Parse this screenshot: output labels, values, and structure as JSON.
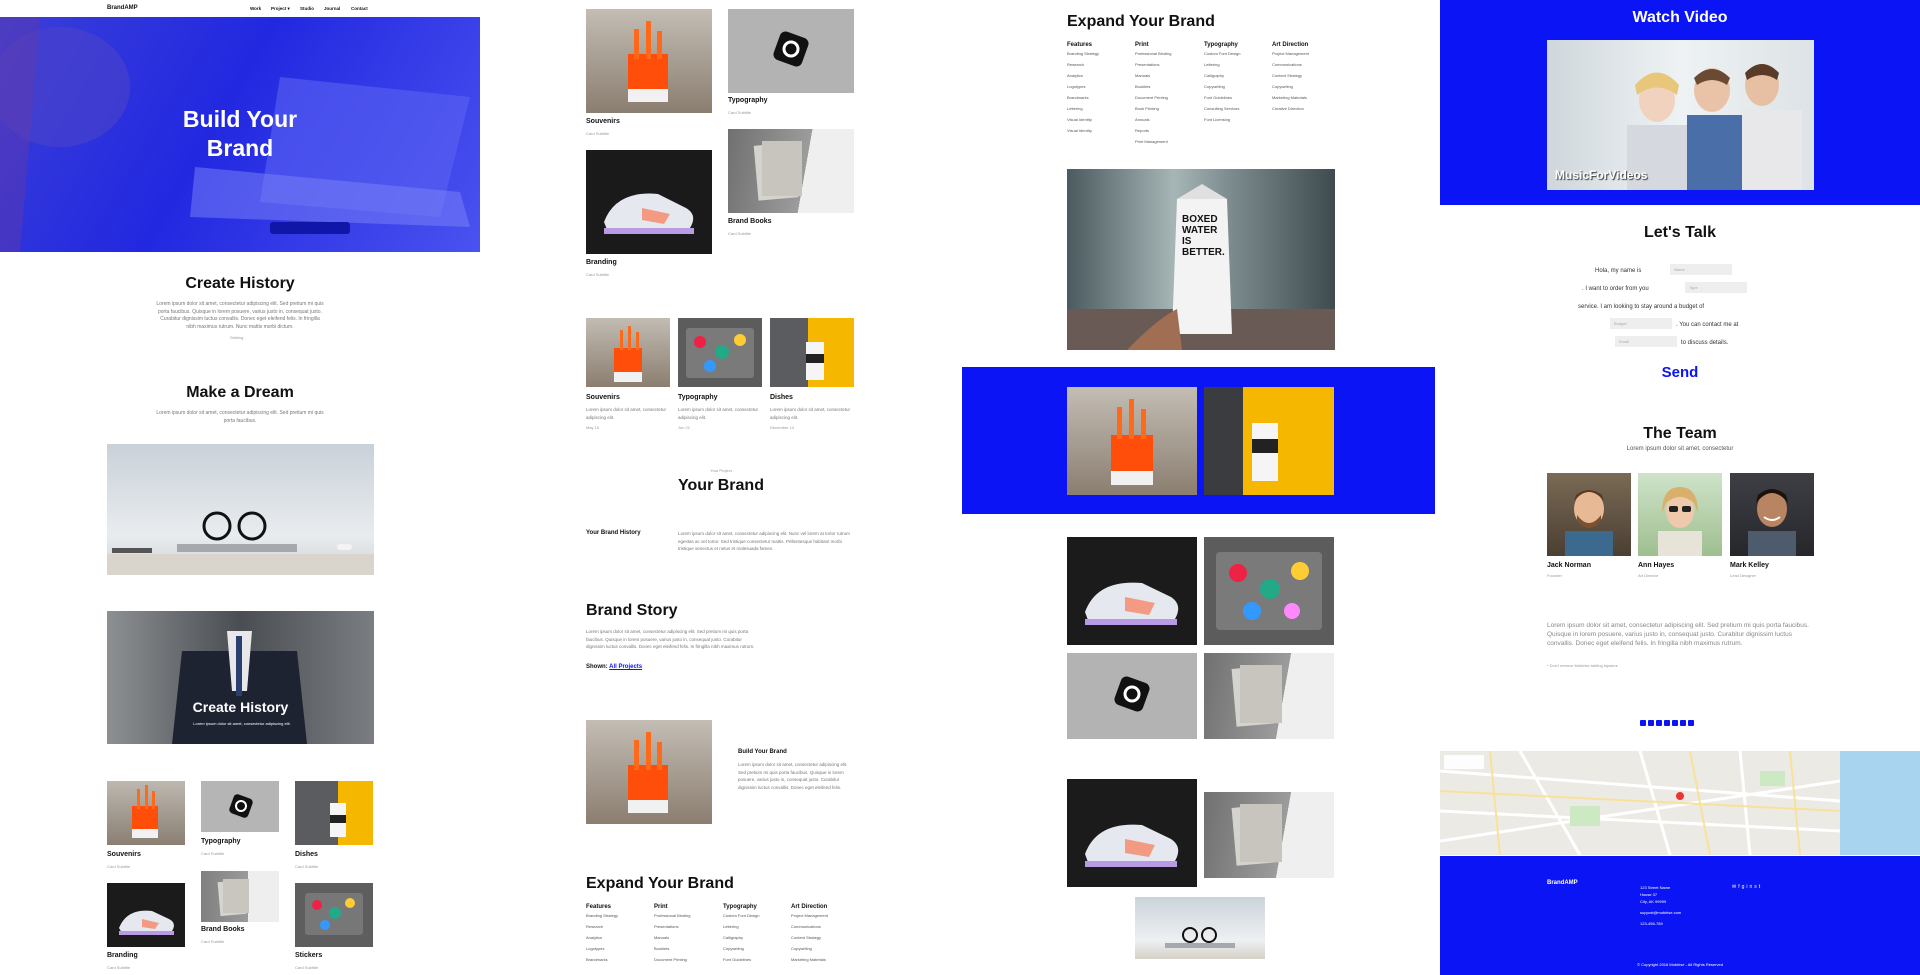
{
  "nav": {
    "brand": "BrandAMP",
    "items": [
      "Work",
      "Project ▾",
      "Studio",
      "Journal",
      "Contact"
    ]
  },
  "hero": {
    "title": "Build Your Brand"
  },
  "history": {
    "title": "Create History",
    "text": "Lorem ipsum dolor sit amet, consectetur adipiscing elit. Sed pretium mi quis porta faucibus. Quisque in lorem posuere, varius justo in, consequat justo. Curabitur dignissim luctus convallis. Donec eget eleifend felis. In fringilla nibh maximus rutrum. Nunc mattis morbi dictum.",
    "caption": "Striking"
  },
  "dream": {
    "title": "Make a Dream",
    "text": "Lorem ipsum dolor sit amet, consectetur adipiscing elit. Sed pretium mi quis porta faucibus."
  },
  "history2": {
    "title": "Create History",
    "text": "Lorem ipsum dolor sit amet, consectetur adipiscing elit."
  },
  "cards": {
    "souvenirs": "Souvenirs",
    "typography": "Typography",
    "dishes": "Dishes",
    "branding": "Branding",
    "brand_books": "Brand Books",
    "stickers": "Stickers",
    "subtitle": "Card Subtitle"
  },
  "col2": {
    "cards_text": "Lorem ipsum dolor sit amet, consectetur adipiscing elit.",
    "dates": [
      "May 10",
      "Jun 21",
      "December 14"
    ],
    "project_kicker": "Your Project",
    "project_title": "Your Brand",
    "history_label": "Your Brand History",
    "history_text": "Lorem ipsum dolor sit amet, consectetur adipiscing elit. Nunc vel lorem at tortor rutrum egestas ac vel tortor. Sed tristique consectetur mattis. Pellentesque habitant morbi tristique senectus et netus et malesuada fames.",
    "story_title": "Brand Story",
    "story_text": "Lorem ipsum dolor sit amet, consectetur adipiscing elit. Sed pretium mi quis porta faucibus. Quisque in lorem posuere, varius justo in, consequat justo. Curabitur dignissim luctus convallis. Donec eget eleifend felis. In fringilla nibh maximus rutrum.",
    "shown_label": "Shown:",
    "shown_link": "All Projects",
    "build_title": "Build Your Brand",
    "build_text": "Lorem ipsum dolor sit amet, consectetur adipiscing elit. Sed pretium mi quis porta faucibus. Quisque in lorem posuere, varius justo in, consequat justo. Curabitur dignissim luctus convallis. Donec eget eleifend felis."
  },
  "expand": {
    "title": "Expand Your Brand",
    "cols": [
      {
        "head": "Features",
        "items": [
          "Branding Strategy",
          "Research",
          "Analytics",
          "Logotypes",
          "Brandmarks",
          "Lettering",
          "Visual Identity",
          "Visual Identity"
        ]
      },
      {
        "head": "Print",
        "items": [
          "Professional Binding",
          "Presentations",
          "Manuals",
          "Booklets",
          "Document Printing",
          "Book Printing",
          "Annuals",
          "Reports",
          "Print Management"
        ]
      },
      {
        "head": "Typography",
        "items": [
          "Custom Font Design",
          "Lettering",
          "Calligraphy",
          "Copywriting",
          "Font Guidelines",
          "Consulting Services",
          "Font Licensing"
        ]
      },
      {
        "head": "Art Direction",
        "items": [
          "Project Management",
          "Communications",
          "Content Strategy",
          "Copywriting",
          "Marketing Materials",
          "Creative Direction"
        ]
      }
    ]
  },
  "product_text": {
    "line1": "BOXED",
    "line2": "WATER",
    "line3": "IS",
    "line4": "BETTER."
  },
  "video": {
    "title": "Watch Video",
    "watermark": "MusicForVideos"
  },
  "talk": {
    "title": "Let's Talk",
    "s1": "Hola, my name is",
    "s2": ". I want to order from you",
    "s3": "service. I am looking to stay around a budget of",
    "s4": ". You can contact me at",
    "s5": "to discuss details.",
    "ph_name": "Name",
    "ph_type": "Type",
    "ph_budget": "Budget",
    "ph_email": "Email",
    "send": "Send"
  },
  "team": {
    "title": "The Team",
    "subtitle": "Lorem ipsum dolor sit amet, consectetur",
    "members": [
      {
        "name": "Jack Norman",
        "role": "Founder"
      },
      {
        "name": "Ann Hayes",
        "role": "Art Director"
      },
      {
        "name": "Mark Kelley",
        "role": "Lead Designer"
      }
    ],
    "text": "Lorem ipsum dolor sit amet, consectetur adipiscing elit. Sed pretium mi quis porta faucibus. Quisque in lorem posuere, varius justo in, consequat justo. Curabitur dignissim luctus convallis. Donec eget eleifend felis. In fringilla nibh maximus rutrum.",
    "note": "* Don't remove Mobirise adding hipsters"
  },
  "footer": {
    "brand": "BrandAMP",
    "address": [
      "123 Street Name",
      "House 37",
      "City, AK 99999"
    ],
    "email": "support@mobirise.com",
    "phone": "123-456-789",
    "copyright": "© Copyright 2016 Mobirise - All Rights Reserved"
  },
  "colors": {
    "accent": "#0a14f5",
    "text": "#111111"
  }
}
